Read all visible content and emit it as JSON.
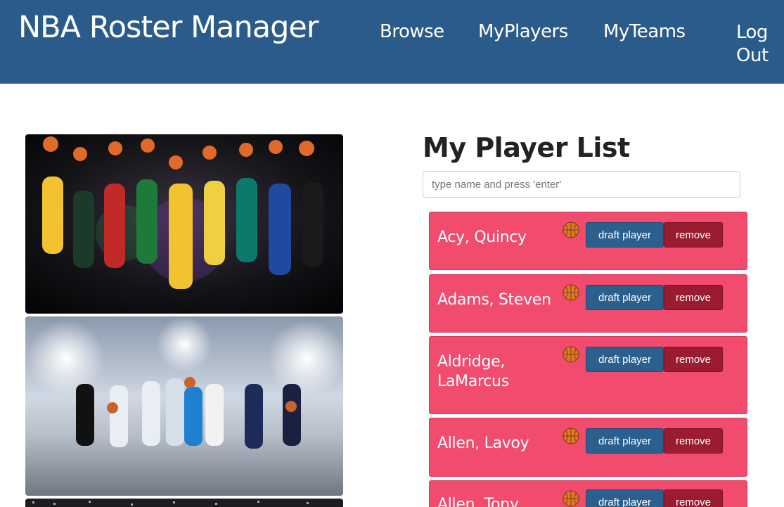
{
  "app": {
    "title": "NBA Roster Manager"
  },
  "nav": {
    "browse": "Browse",
    "myplayers": "MyPlayers",
    "myteams": "MyTeams",
    "logout": "Log Out"
  },
  "main": {
    "heading": "My Player List",
    "search_placeholder": "type name and press 'enter'",
    "draft_label": "draft player",
    "remove_label": "remove",
    "players": [
      {
        "name": "Acy, Quincy"
      },
      {
        "name": "Adams, Steven"
      },
      {
        "name": "Aldridge, LaMarcus"
      },
      {
        "name": "Allen, Lavoy"
      },
      {
        "name": "Allen, Tony"
      }
    ]
  },
  "colors": {
    "navbar": "#2b5b8a",
    "card": "#f14b6d",
    "draft_button": "#2b5f8e",
    "remove_button": "#9b1b30"
  },
  "icons": {
    "player_icon": "basketball-icon"
  }
}
